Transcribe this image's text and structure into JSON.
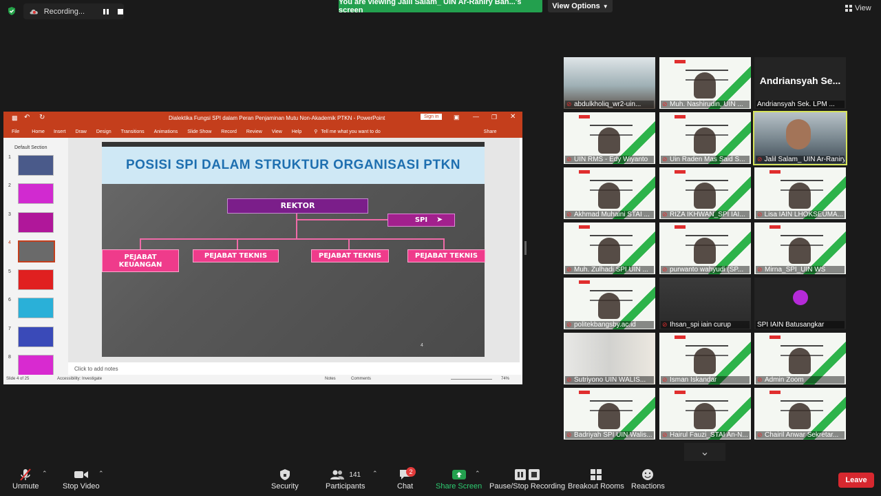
{
  "top_bar": {
    "recording_label": "Recording...",
    "viewing_banner": "You are viewing Jalil Salam_ UIN Ar-Raniry Ban...'s screen",
    "view_options": "View Options",
    "view_button": "View"
  },
  "powerpoint": {
    "title": "Dialektika Fungsi SPI dalam Peran Penjaminan Mutu Non-Akademik PTKN  -  PowerPoint",
    "sign_in": "Sign in",
    "tabs": [
      "File",
      "Home",
      "Insert",
      "Draw",
      "Design",
      "Transitions",
      "Animations",
      "Slide Show",
      "Record",
      "Review",
      "View",
      "Help"
    ],
    "tell_me": "Tell me what you want to do",
    "share": "Share",
    "section_label": "Default Section",
    "thumb_numbers": [
      "1",
      "2",
      "3",
      "4",
      "5",
      "6",
      "7",
      "8"
    ],
    "notes_placeholder": "Click to add notes",
    "status_slide": "Slide 4 of 25",
    "status_accessibility": "Accessibility: Investigate",
    "status_notes": "Notes",
    "status_comments": "Comments",
    "zoom_level": "74%",
    "slide_number": "4"
  },
  "slide": {
    "title": "POSISI SPI DALAM STRUKTUR ORGANISASI PTKN",
    "rektor": "REKTOR",
    "spi": "SPI",
    "boxes": [
      "PEJABAT KEUANGAN",
      "PEJABAT  TEKNIS",
      "PEJABAT  TEKNIS",
      "PEJABAT  TEKNIS"
    ]
  },
  "participants_tiles": [
    {
      "name": "abdulkholiq_wr2-uin...",
      "type": "office"
    },
    {
      "name": "Muh. Nashirudin, UIN ...",
      "type": "slide"
    },
    {
      "name": "Andriansyah Sek. LPM ...",
      "type": "nameonly",
      "display": "Andriansyah Se..."
    },
    {
      "name": "UIN RMS - Edy Wiyanto",
      "type": "slide"
    },
    {
      "name": "Uin Raden Mas Said S...",
      "type": "slide"
    },
    {
      "name": "Jalil Salam_ UIN Ar-Raniry...",
      "type": "cam",
      "speaking": true
    },
    {
      "name": "Akhmad Muhaini STAI ...",
      "type": "slide"
    },
    {
      "name": "RIZA IKHWAN_SPI IAI...",
      "type": "slide"
    },
    {
      "name": "Lisa IAIN LHOKSEUMA...",
      "type": "slide"
    },
    {
      "name": "Muh. Zulhadi SPI UIN ...",
      "type": "slide"
    },
    {
      "name": "purwanto wahyudi (SP...",
      "type": "slide"
    },
    {
      "name": "Mirna_SPI_UIN WS",
      "type": "slide"
    },
    {
      "name": "politekbangsby.ac.id",
      "type": "slide"
    },
    {
      "name": "Ihsan_spi iain curup",
      "type": "dark"
    },
    {
      "name": "SPI IAIN Batusangkar",
      "type": "avatar"
    },
    {
      "name": "Sutriyono UIN WALIS...",
      "type": "room"
    },
    {
      "name": "Isman Iskandar",
      "type": "slide"
    },
    {
      "name": "Admin Zoom",
      "type": "slide"
    },
    {
      "name": "Badriyah SPI UIN Walis...",
      "type": "slide"
    },
    {
      "name": "Hairul Fauzi_STAI An-N...",
      "type": "slide"
    },
    {
      "name": "Chairil Anwar Sekretar...",
      "type": "slide"
    }
  ],
  "toolbar": {
    "unmute": "Unmute",
    "stop_video": "Stop Video",
    "security": "Security",
    "participants": "Participants",
    "participants_count": "141",
    "chat": "Chat",
    "chat_badge": "2",
    "share_screen": "Share Screen",
    "pause_stop_recording": "Pause/Stop Recording",
    "breakout_rooms": "Breakout Rooms",
    "reactions": "Reactions",
    "leave": "Leave"
  },
  "colors": {
    "share_green": "#23a04e",
    "ppt_red": "#c43e1c",
    "leave_red": "#d7282f",
    "active_speaker": "#d6e35a"
  }
}
